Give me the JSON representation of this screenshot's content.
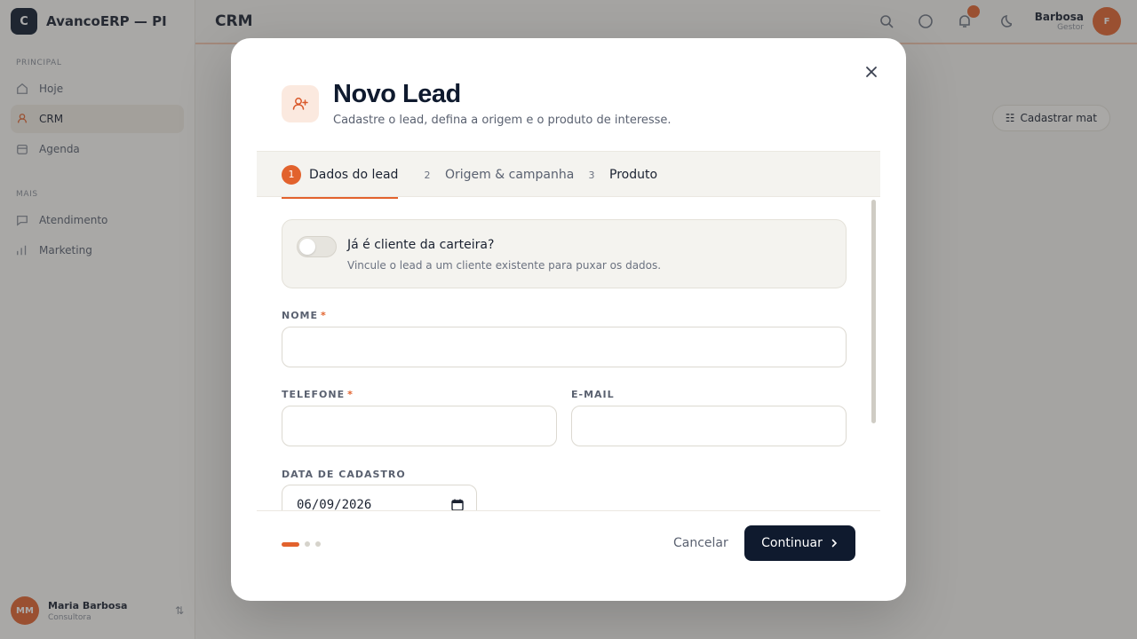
{
  "app": {
    "brand_initial": "C",
    "brand_name": "AvancoERP — PI",
    "page_title": "CRM",
    "sidebar": {
      "section1": "PRINCIPAL",
      "section2": "MAIS",
      "items": [
        {
          "label": "Hoje",
          "icon": "home-icon"
        },
        {
          "label": "CRM",
          "icon": "crm-icon"
        },
        {
          "label": "Agenda",
          "icon": "calendar-icon"
        },
        {
          "label": "Atendimento",
          "icon": "chat-icon"
        },
        {
          "label": "Marketing",
          "icon": "chart-icon"
        }
      ],
      "user": {
        "initials": "MM",
        "name": "Maria Barbosa",
        "role": "Consultora"
      }
    },
    "topbar": {
      "user_name": "Barbosa",
      "user_role": "Gestor",
      "user_initial": "F"
    },
    "bg_button": "Cadastrar mat"
  },
  "modal": {
    "title": "Novo Lead",
    "subtitle": "Cadastre o lead, defina a origem e o produto de interesse.",
    "header_icon": "user-plus-icon",
    "steps": [
      {
        "num": "1",
        "label": "Dados do lead",
        "active": true
      },
      {
        "num": "2",
        "label": "Origem & campanha",
        "active": false
      },
      {
        "num": "3",
        "label": "Produto",
        "active": false
      }
    ],
    "client_toggle": {
      "title": "Já é cliente da carteira?",
      "description": "Vincule o lead a um cliente existente para puxar os dados.",
      "checked": false
    },
    "fields": {
      "nome": {
        "label": "NOME",
        "required": "*",
        "value": ""
      },
      "telefone": {
        "label": "TELEFONE",
        "required": "*",
        "value": ""
      },
      "email": {
        "label": "E-MAIL",
        "value": ""
      },
      "data_cadastro": {
        "label": "DATA DE CADASTRO",
        "value": "06/09/2026"
      }
    },
    "footer": {
      "cancel_label": "Cancelar",
      "continue_label": "Continuar",
      "progress_step": 1,
      "progress_total": 3
    },
    "colors": {
      "accent": "#e2622d",
      "primary": "#0f1a2e"
    }
  }
}
